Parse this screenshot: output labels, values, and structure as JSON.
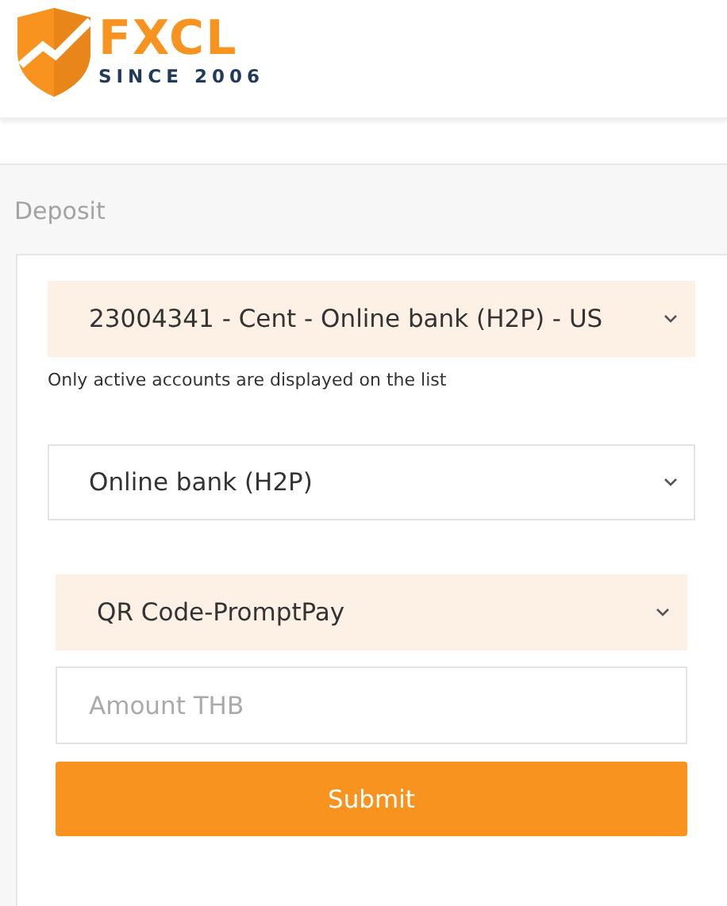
{
  "logo": {
    "name": "FXCL",
    "tagline": "SINCE 2006"
  },
  "page_title": "Deposit",
  "form": {
    "fields": [
      {
        "kind": "select",
        "value": "23004341 - Cent - Online bank (H2P) - US",
        "highlighted": true,
        "inset": false
      },
      {
        "kind": "note",
        "text": "Only active accounts are displayed on the list"
      },
      {
        "kind": "select",
        "value": "Online bank (H2P)",
        "highlighted": false,
        "inset": false
      },
      {
        "kind": "select",
        "value": "QR Code-PromptPay",
        "highlighted": true,
        "inset": true
      },
      {
        "kind": "input",
        "placeholder": "Amount THB",
        "inset": true
      },
      {
        "kind": "button",
        "label": "Submit",
        "inset": true
      }
    ]
  }
}
